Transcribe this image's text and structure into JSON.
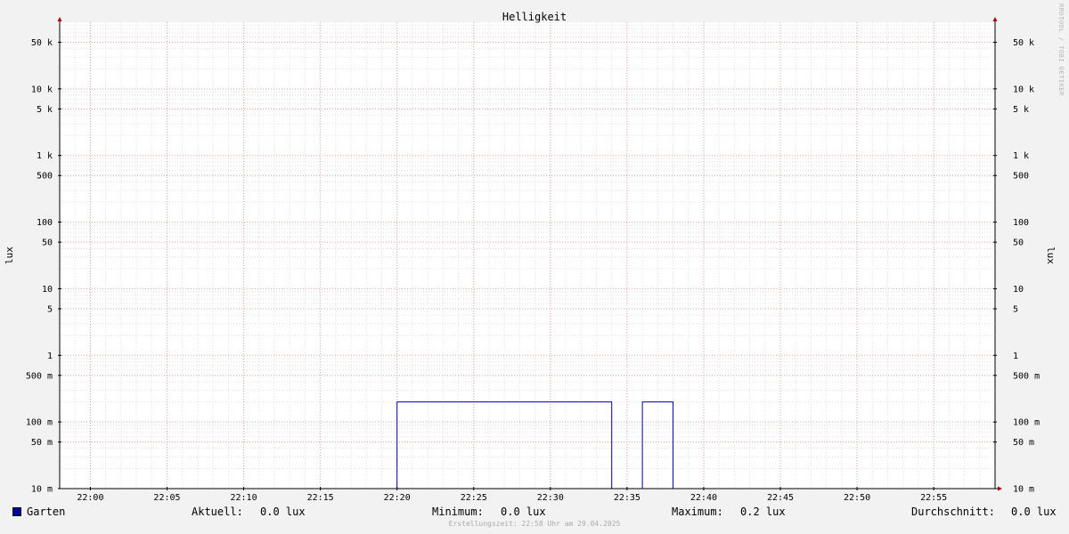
{
  "chart_data": {
    "type": "line",
    "title": "Helligkeit",
    "ylabel_left": "lux",
    "ylabel_right": "lux",
    "yscale": "log",
    "ylim": [
      0.01,
      100000
    ],
    "xlim": [
      "21:58",
      "22:59"
    ],
    "x_ticks": [
      "22:00",
      "22:05",
      "22:10",
      "22:15",
      "22:20",
      "22:25",
      "22:30",
      "22:35",
      "22:40",
      "22:45",
      "22:50",
      "22:55"
    ],
    "y_ticks": [
      {
        "value": 50000,
        "label": "50 k"
      },
      {
        "value": 10000,
        "label": "10 k"
      },
      {
        "value": 5000,
        "label": "5 k"
      },
      {
        "value": 1000,
        "label": "1 k"
      },
      {
        "value": 500,
        "label": "500"
      },
      {
        "value": 100,
        "label": "100"
      },
      {
        "value": 50,
        "label": "50"
      },
      {
        "value": 10,
        "label": "10"
      },
      {
        "value": 5,
        "label": "5"
      },
      {
        "value": 1,
        "label": "1"
      },
      {
        "value": 0.5,
        "label": "500 m"
      },
      {
        "value": 0.1,
        "label": "100 m"
      },
      {
        "value": 0.05,
        "label": "50 m"
      },
      {
        "value": 0.01,
        "label": "10 m"
      }
    ],
    "grid": true,
    "series": [
      {
        "name": "Garten",
        "color": "#0000a0",
        "points": [
          {
            "x": "21:58",
            "y": 0.0
          },
          {
            "x": "22:20",
            "y": 0.0
          },
          {
            "x": "22:20",
            "y": 0.2
          },
          {
            "x": "22:34",
            "y": 0.2
          },
          {
            "x": "22:34",
            "y": 0.0
          },
          {
            "x": "22:36",
            "y": 0.0
          },
          {
            "x": "22:36",
            "y": 0.2
          },
          {
            "x": "22:38",
            "y": 0.2
          },
          {
            "x": "22:38",
            "y": 0.0
          },
          {
            "x": "22:59",
            "y": 0.0
          }
        ]
      }
    ]
  },
  "legend": {
    "series_name": "Garten",
    "current_label": "Aktuell:",
    "current_value": "0.0 lux",
    "min_label": "Minimum:",
    "min_value": "0.0 lux",
    "max_label": "Maximum:",
    "max_value": "0.2 lux",
    "avg_label": "Durchschnitt:",
    "avg_value": "0.0 lux"
  },
  "footer": "Erstellungszeit: 22:58 Uhr am 29.04.2025",
  "watermark": "RRDTOOL / TOBI OETIKER"
}
